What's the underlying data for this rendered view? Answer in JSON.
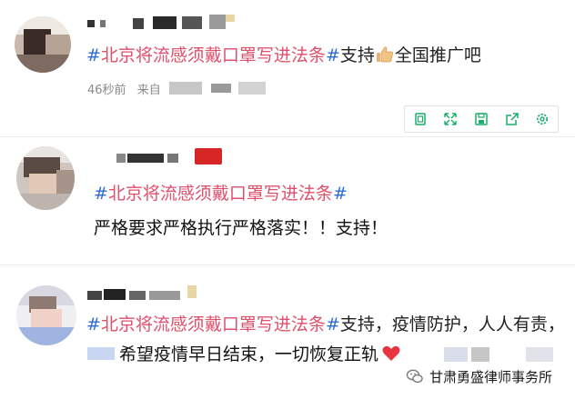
{
  "posts": [
    {
      "content_parts": {
        "topic": "#北京将流感须戴口罩写进法条#",
        "after": "支持",
        "tail": "全国推广吧"
      },
      "time": "46秒前",
      "source_label": "来自"
    },
    {
      "content_parts": {
        "topic": "#北京将流感须戴口罩写进法条#"
      },
      "body": "严格要求严格执行严格落实！！支持！"
    },
    {
      "content_parts": {
        "topic": "#北京将流感须戴口罩写进法条#",
        "after": "支持，疫情防护，人人有责，"
      },
      "body": "希望疫情早日结束，一切恢复正轨"
    }
  ],
  "toolbar": {
    "icons": [
      "copy-icon",
      "expand-icon",
      "save-icon",
      "share-icon",
      "settings-icon"
    ],
    "color": "#1aad6a"
  },
  "watermark": {
    "text": "甘肃勇盛律师事务所"
  },
  "colors": {
    "topic_red": "#e0506b",
    "hash_blue": "#2f6cd4",
    "heart_red": "#e8343e"
  }
}
